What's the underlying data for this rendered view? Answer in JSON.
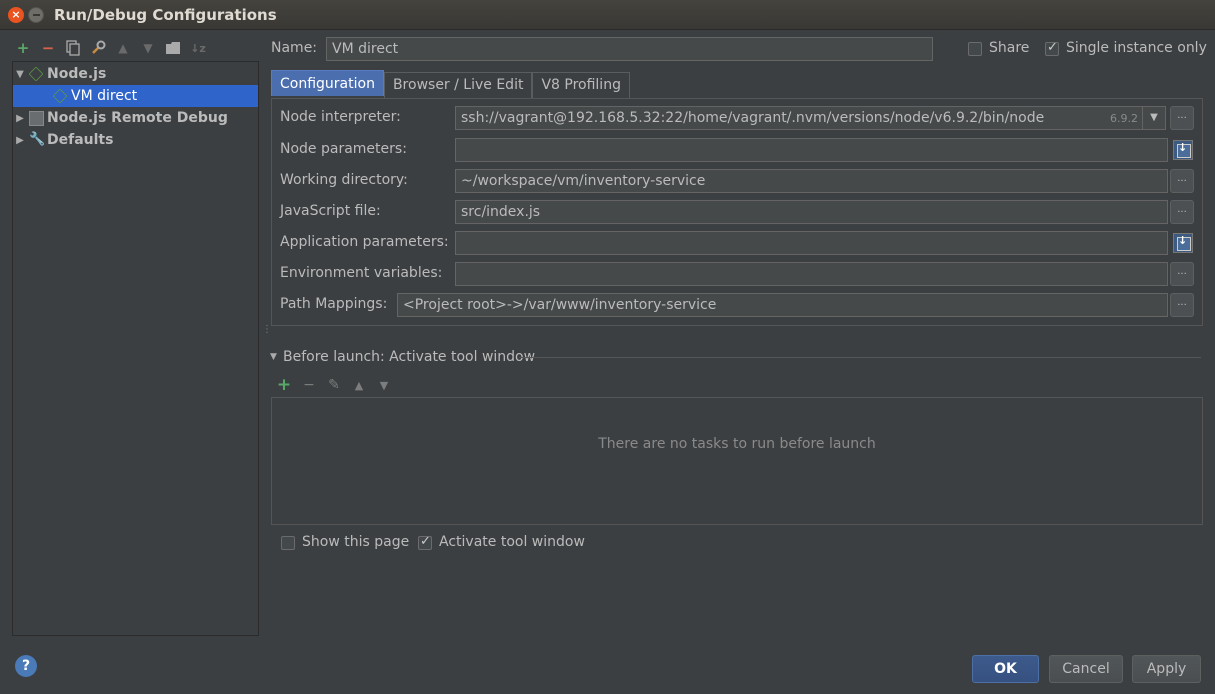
{
  "window": {
    "title": "Run/Debug Configurations",
    "close": "×"
  },
  "toolbar": {
    "add": "+",
    "remove": "−"
  },
  "tree": [
    {
      "label": "Node.js",
      "expanded": true
    },
    {
      "label": "VM direct",
      "selected": true
    },
    {
      "label": "Node.js Remote Debug",
      "expanded": false
    },
    {
      "label": "Defaults",
      "expanded": false
    }
  ],
  "name": {
    "label": "Name:",
    "value": "VM direct"
  },
  "share": {
    "label": "Share",
    "checked": false
  },
  "single_instance": {
    "label": "Single instance only",
    "checked": true
  },
  "tabs": [
    "Configuration",
    "Browser / Live Edit",
    "V8 Profiling"
  ],
  "config": {
    "node_interpreter": {
      "label": "Node interpreter:",
      "value": "ssh://vagrant@192.168.5.32:22/home/vagrant/.nvm/versions/node/v6.9.2/bin/node",
      "version": "6.9.2"
    },
    "node_parameters": {
      "label": "Node parameters:",
      "value": ""
    },
    "working_directory": {
      "label": "Working directory:",
      "value": "~/workspace/vm/inventory-service"
    },
    "javascript_file": {
      "label": "JavaScript file:",
      "value": "src/index.js"
    },
    "application_parameters": {
      "label": "Application parameters:",
      "value": ""
    },
    "environment_variables": {
      "label": "Environment variables:",
      "value": ""
    },
    "path_mappings": {
      "label": "Path Mappings:",
      "value": "<Project root>->/var/www/inventory-service"
    },
    "browse": "..."
  },
  "before_launch": {
    "title": "Before launch: Activate tool window",
    "empty_text": "There are no tasks to run before launch"
  },
  "show_this_page": {
    "label": "Show this page",
    "checked": false
  },
  "activate_tool_window": {
    "label": "Activate tool window",
    "checked": true
  },
  "buttons": {
    "ok": "OK",
    "cancel": "Cancel",
    "apply": "Apply"
  },
  "help": "?"
}
